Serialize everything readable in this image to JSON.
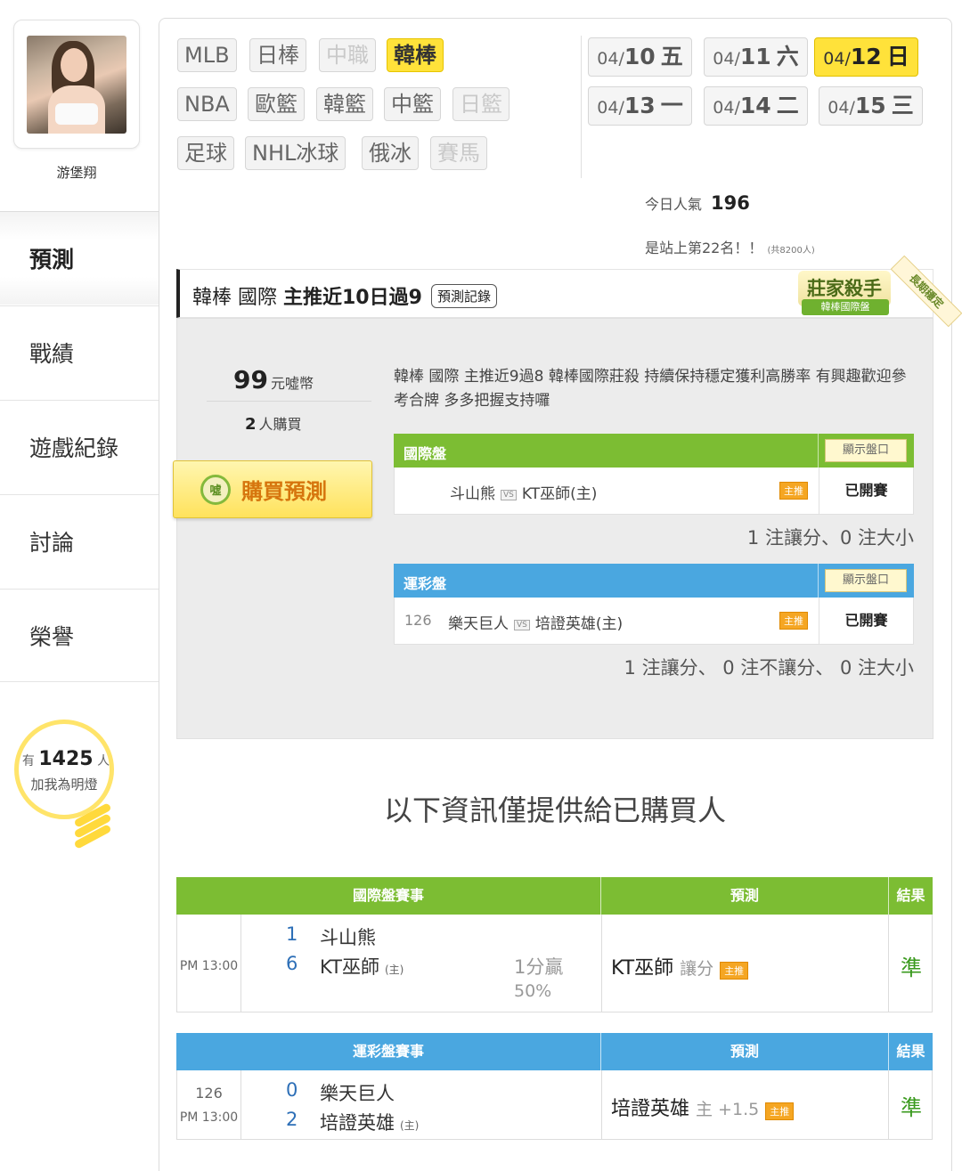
{
  "user": {
    "name": "游堡翔"
  },
  "sidebar": {
    "items": [
      {
        "label": "預測",
        "active": true
      },
      {
        "label": "戰績"
      },
      {
        "label": "遊戲紀錄"
      },
      {
        "label": "討論"
      },
      {
        "label": "榮譽"
      }
    ]
  },
  "bulb": {
    "prefix": "有",
    "count": "1425",
    "suffix": "人",
    "subtitle": "加我為明燈"
  },
  "sports": {
    "row1": [
      {
        "label": "MLB"
      },
      {
        "label": "日棒"
      },
      {
        "label": "中職",
        "dim": true
      },
      {
        "label": "韓棒",
        "active": true
      }
    ],
    "row2": [
      {
        "label": "NBA"
      },
      {
        "label": "歐籃"
      },
      {
        "label": "韓籃"
      },
      {
        "label": "中籃"
      },
      {
        "label": "日籃",
        "dim": true
      }
    ],
    "row3": [
      {
        "label": "足球"
      },
      {
        "label": "NHL冰球"
      },
      {
        "label": "俄冰"
      },
      {
        "label": "賽馬",
        "dim": true
      }
    ]
  },
  "dates": [
    {
      "md": "04/",
      "d": "10",
      "wd": "五"
    },
    {
      "md": "04/",
      "d": "11",
      "wd": "六"
    },
    {
      "md": "04/",
      "d": "12",
      "wd": "日",
      "active": true
    },
    {
      "md": "04/",
      "d": "13",
      "wd": "一"
    },
    {
      "md": "04/",
      "d": "14",
      "wd": "二"
    },
    {
      "md": "04/",
      "d": "15",
      "wd": "三"
    }
  ],
  "popularity": {
    "label": "今日人氣",
    "value": "196",
    "rank_text": "是站上第22名！！",
    "rank_total": "(共8200人)"
  },
  "prediction": {
    "title_prefix": "韓棒 國際",
    "title_bold": "主推近10日過9",
    "record_button": "預測記錄",
    "badge_main": "莊家殺手",
    "badge_sub": "韓棒國際盤",
    "badge_ribbon": "長期穩定",
    "price": "99",
    "price_unit": "元噓幣",
    "buyers": "2",
    "buyers_unit": "人購買",
    "buy_button": "購買預測",
    "buy_icon_text": "噓",
    "description": "韓棒 國際 主推近9過8 韓棒國際莊殺 持續保持穩定獲利高勝率 有興趣歡迎參考合牌 多多把握支持囉"
  },
  "markets": [
    {
      "name": "國際盤",
      "show_button": "顯示盤口",
      "num": "",
      "away": "斗山熊",
      "home": "KT巫師(主)",
      "vs": "VS",
      "rec": "主推",
      "status": "已開賽",
      "summary": "1 注讓分、0 注大小"
    },
    {
      "name": "運彩盤",
      "show_button": "顯示盤口",
      "num": "126",
      "away": "樂天巨人",
      "home": "培證英雄(主)",
      "vs": "VS",
      "rec": "主推",
      "status": "已開賽",
      "summary": "1 注讓分、 0 注不讓分、 0 注大小"
    }
  ],
  "notice": "以下資訊僅提供給已購買人",
  "results": [
    {
      "header": "國際盤賽事",
      "pred_header": "預測",
      "result_header": "結果",
      "num": "",
      "time": "PM 13:00",
      "away_score": "1",
      "away": "斗山熊",
      "home_score": "6",
      "home": "KT巫師",
      "home_mark": "(主)",
      "win_text": "1分贏",
      "pct": "50%",
      "pred_team": "KT巫師",
      "pred_detail": "讓分",
      "rec": "主推",
      "result": "準"
    },
    {
      "header": "運彩盤賽事",
      "pred_header": "預測",
      "result_header": "結果",
      "num": "126",
      "time": "PM 13:00",
      "away_score": "0",
      "away": "樂天巨人",
      "home_score": "2",
      "home": "培證英雄",
      "home_mark": "(主)",
      "win_text": "",
      "pct": "",
      "pred_team": "培證英雄",
      "pred_detail": "主 +1.5",
      "rec": "主推",
      "result": "準"
    }
  ]
}
